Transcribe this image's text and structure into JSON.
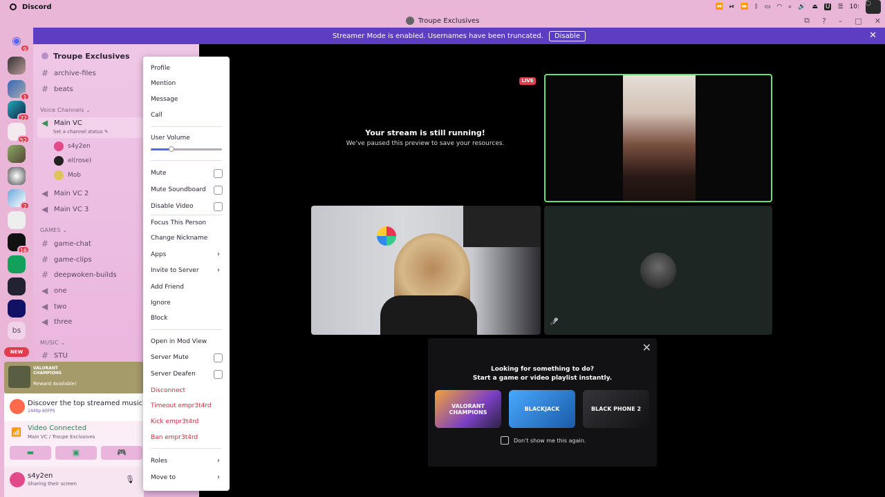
{
  "menubar": {
    "app_name": "Discord",
    "clock": "10:"
  },
  "window": {
    "title": "Troupe Exclusives"
  },
  "banner": {
    "text": "Streamer Mode is enabled. Usernames have been truncated.",
    "button": "Disable"
  },
  "guilds": {
    "badges": [
      "9",
      "1",
      "22",
      "52",
      "2",
      "16"
    ],
    "text_server": "bs",
    "new_label": "NEW"
  },
  "sidebar": {
    "server_name": "Troupe Exclusives",
    "channels_top": [
      "archive-files",
      "beats"
    ],
    "voice_category": "Voice Channels",
    "active_vc": "Main VC",
    "active_vc_status": "Set a channel status",
    "members": [
      "s4y2en",
      "el(rose)",
      "Mob"
    ],
    "other_vcs": [
      "Main VC 2",
      "Main VC 3"
    ],
    "games_category": "GAMES",
    "games_channels": [
      {
        "name": "game-chat",
        "type": "text"
      },
      {
        "name": "game-clips",
        "type": "text"
      },
      {
        "name": "deepwoken-builds",
        "type": "text"
      },
      {
        "name": "one",
        "type": "voice"
      },
      {
        "name": "two",
        "type": "voice"
      },
      {
        "name": "three",
        "type": "voice"
      }
    ],
    "music_category": "MUSIC",
    "music_channels": [
      "STU"
    ]
  },
  "promo": {
    "title_line1": "VALORANT",
    "title_line2": "CHAMPIONS",
    "reward": "Reward Available!"
  },
  "activity": {
    "title": "Discover the top streamed music and",
    "sub": "1440p 60FPS"
  },
  "voice_panel": {
    "title": "Video Connected",
    "sub": "Main VC / Troupe Exclusives"
  },
  "user": {
    "name": "s4y2en",
    "status": "Sharing their screen"
  },
  "context_menu": {
    "group1": [
      "Profile",
      "Mention",
      "Message",
      "Call"
    ],
    "volume_label": "User Volume",
    "volume_level": 0.29,
    "group2": [
      "Mute",
      "Mute Soundboard",
      "Disable Video"
    ],
    "group3": [
      "Focus This Person",
      "Change Nickname",
      "Apps",
      "Invite to Server",
      "Add Friend",
      "Ignore",
      "Block"
    ],
    "mod_view": "Open in Mod View",
    "group4": [
      "Server Mute",
      "Server Deafen"
    ],
    "red_items": [
      "Disconnect",
      "Timeout empr3t4rd",
      "Kick empr3t4rd",
      "Ban empr3t4rd"
    ],
    "group5": [
      "Roles",
      "Move to"
    ]
  },
  "stream": {
    "live": "LIVE",
    "paused_title": "Your stream is still running!",
    "paused_sub": "We've paused this preview to save your resources."
  },
  "activities": {
    "q1": "Looking for something to do?",
    "q2": "Start a game or video playlist instantly.",
    "cards": [
      "VALORANT CHAMPIONS",
      "BLACKJACK",
      "BLACK PHONE 2"
    ],
    "dont_show": "Don't show me this again."
  },
  "colors": {
    "accent": "#5c3ec2",
    "sidebar": "#efc7e6",
    "live": "#e03e4e",
    "speaking": "#6ae06e"
  }
}
